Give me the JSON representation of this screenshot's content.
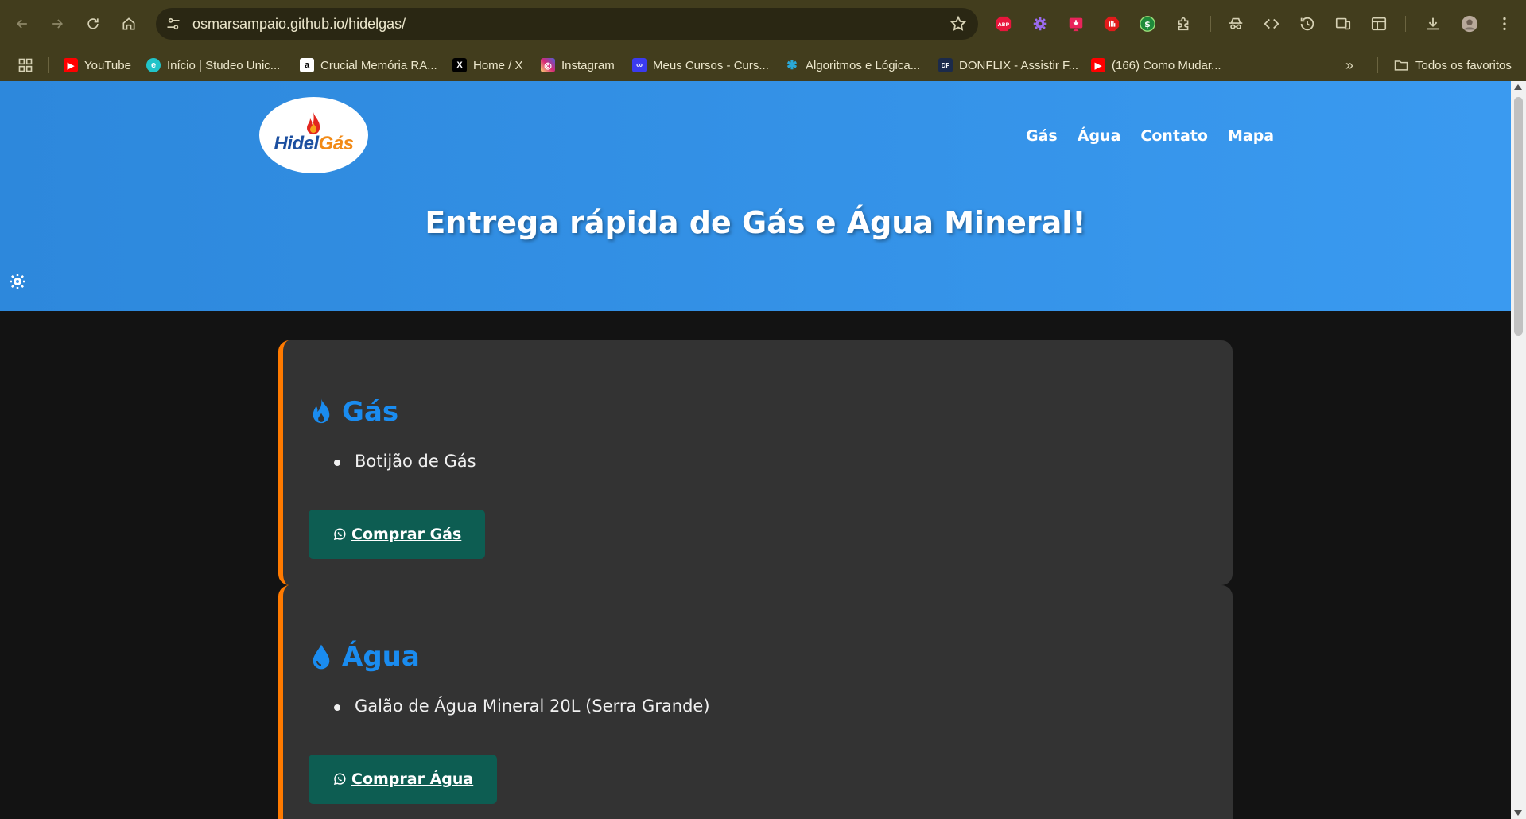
{
  "browser": {
    "url": "osmarsampaio.github.io/hidelgas/",
    "bookmarks": [
      {
        "label": "YouTube",
        "icon": "youtube-icon",
        "color": "#ff0000"
      },
      {
        "label": "Início | Studeo Unic...",
        "icon": "studeo-icon",
        "color": "#21c4c9"
      },
      {
        "label": "Crucial Memória RA...",
        "icon": "amazon-icon",
        "color": "#ffffff"
      },
      {
        "label": "Home / X",
        "icon": "x-icon",
        "color": "#000000"
      },
      {
        "label": "Instagram",
        "icon": "instagram-icon",
        "color": "#d62976"
      },
      {
        "label": "Meus Cursos - Curs...",
        "icon": "cursos-icon",
        "color": "#3b3bf0"
      },
      {
        "label": "Algoritmos e Lógica...",
        "icon": "algoritmos-icon",
        "color": "#2aa8d8"
      },
      {
        "label": "DONFLIX - Assistir F...",
        "icon": "donflix-icon",
        "color": "#1b2a4a"
      },
      {
        "label": "(166) Como Mudar...",
        "icon": "youtube-icon",
        "color": "#ff0000"
      }
    ],
    "all_bookmarks_label": "Todos os favoritos",
    "extensions": [
      "adblock-icon",
      "puzzle-gear-icon",
      "download-video-icon",
      "stop-hand-icon",
      "dollar-icon",
      "extensions-icon",
      "incognito-icon",
      "code-icon",
      "history-icon",
      "devices-icon",
      "sidebar-icon",
      "download-icon",
      "avatar-icon",
      "more-icon"
    ],
    "adblock_label": "ABP"
  },
  "site": {
    "logo": {
      "part1": "Hidel",
      "part2": "Gás"
    },
    "nav": [
      "Gás",
      "Água",
      "Contato",
      "Mapa"
    ],
    "hero_title": "Entrega rápida de Gás e Água Mineral!",
    "colors": {
      "header": "#3a9af0",
      "accent": "#ff7a00",
      "heading": "#1a8cf0",
      "button": "#0d5d52",
      "card": "#333333",
      "background": "#131313"
    },
    "sections": [
      {
        "title": "Gás",
        "icon": "fire-icon",
        "items": [
          "Botijão de Gás"
        ],
        "button": "Comprar Gás"
      },
      {
        "title": "Água",
        "icon": "water-drop-icon",
        "items": [
          "Galão de Água Mineral 20L (Serra Grande)"
        ],
        "button": "Comprar Água"
      }
    ]
  }
}
